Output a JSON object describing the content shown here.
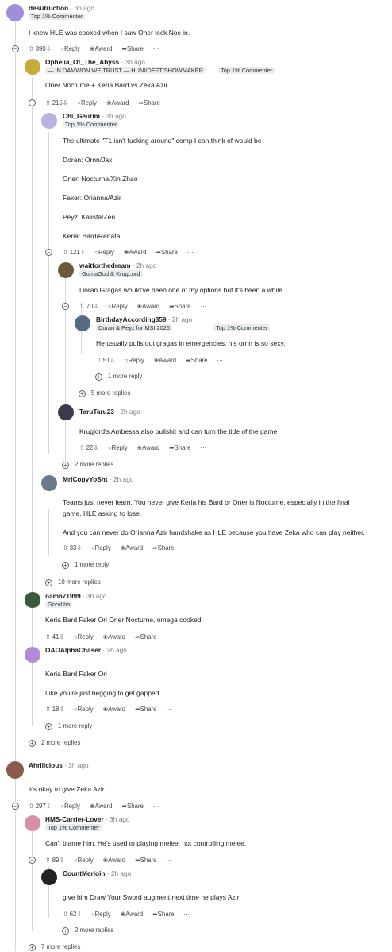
{
  "labels": {
    "reply": "Reply",
    "award": "Award",
    "share": "Share",
    "more": "···",
    "dot": "·"
  },
  "icons": {
    "upvote": "upvote-icon",
    "downvote": "downvote-icon",
    "reply": "reply-icon",
    "award": "award-icon",
    "share": "share-icon",
    "collapse": "collapse-icon",
    "expand": "expand-icon"
  },
  "comments": [
    {
      "user": "desutruction",
      "time": "3h ago",
      "flair": "Top 1% Commenter",
      "text": [
        "I knew HLE was cooked when I saw Oner lock Noc in."
      ],
      "votes": "390"
    },
    {
      "user": "Ophelia_Of_The_Abyss",
      "time": "3h ago",
      "flair": "— IN DAMWON WE TRUST — HUNI/DEFT/SHOWMAKER",
      "flair2": "Top 1% Commenter",
      "text": [
        "Oner Nocturne + Keria Bard vs Zeka Azir"
      ],
      "votes": "215"
    },
    {
      "user": "Chi_Geurim",
      "time": "3h ago",
      "flair": "Top 1% Commenter",
      "text": [
        "The ultimate \"T1 isn't fucking around\" comp I can think of would be",
        "Doran: Ornn/Jax",
        "Oner: Nocturne/Xin Zhao",
        "Faker: Orianna/Azir",
        "Peyz: Kalista/Zeri",
        "Keria: Bard/Renata"
      ],
      "votes": "121"
    },
    {
      "user": "waitforthedream",
      "time": "2h ago",
      "flair": "GumaGod & KrugLord",
      "text": [
        "Doran Gragas would've been one of my options but it's been a while"
      ],
      "votes": "70"
    },
    {
      "user": "BirthdayAccording359",
      "time": "2h ago",
      "flair": "Doran & Peyz for MSI 2026",
      "flair2": "Top 1% Commenter",
      "text": [
        "He usually pulls out gragas in emergencies, his ornn is so sexy."
      ],
      "votes": "51"
    },
    {
      "user": "TaruTaru23",
      "time": "2h ago",
      "text": [
        "Kruglord's Ambessa also bullshit and can turn the tide of the game"
      ],
      "votes": "22"
    },
    {
      "user": "MrICopyYoSht",
      "time": "2h ago",
      "text": [
        "Teams just never learn. You never give Keria his Bard or Oner is Nocturne, especially in the final",
        "game. HLE asking to lose.",
        "And you can never do Orianna Azir handshake as HLE because you have Zeka who can play neither."
      ],
      "votes": "33"
    },
    {
      "user": "nam671999",
      "time": "3h ago",
      "flair": "Good bo",
      "text": [
        "Keria Bard Faker Ori Oner Nocturne, omega cooked"
      ],
      "votes": "41"
    },
    {
      "user": "OAOAlphaChaser",
      "time": "2h ago",
      "text": [
        "Keria Bard Faker Ori",
        "Like you're just begging to get gapped"
      ],
      "votes": "18"
    },
    {
      "user": "Ahrilicious",
      "time": "3h ago",
      "text": [
        "it's okay to give Zeka Azir"
      ],
      "votes": "297"
    },
    {
      "user": "HMS-Carrier-Lover",
      "time": "3h ago",
      "flair": "Top 1% Commenter",
      "text": [
        "Can't blame him. He's used to playing melee, not controlling melee."
      ],
      "votes": "89"
    },
    {
      "user": "CountMerloin",
      "time": "2h ago",
      "text": [
        "give him Draw Your Sword augment next time he plays Azir"
      ],
      "votes": "62"
    }
  ],
  "more_replies": [
    "1 more reply",
    "5 more replies",
    "2 more replies",
    "1 more reply",
    "10 more replies",
    "1 more reply",
    "2 more replies",
    "2 more replies",
    "7 more replies"
  ],
  "colors": {
    "line": "#d5d9dc",
    "text": "#1c1c1c",
    "meta": "#7c7c7c"
  }
}
